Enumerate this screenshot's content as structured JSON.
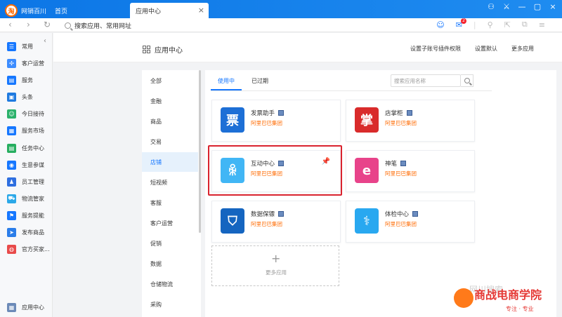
{
  "titlebar": {
    "brand": "网销百川",
    "logo_glyph": "淘",
    "home_tab": "首页",
    "active_tab": "应用中心",
    "close_glyph": "×",
    "window_controls": [
      "⚇",
      "⚔",
      "—",
      "▢",
      "×"
    ]
  },
  "addressbar": {
    "back": "‹",
    "forward": "›",
    "refresh": "↻",
    "search_placeholder": "搜索应用、常用网址",
    "message_badge": "2"
  },
  "sidebar": {
    "collapse": "‹",
    "items": [
      {
        "label": "常用",
        "color": "#1677ff",
        "glyph": "☰"
      },
      {
        "label": "客户运营",
        "color": "#3c8cff",
        "glyph": "✣"
      },
      {
        "label": "服务",
        "color": "#1677ff",
        "glyph": "▤"
      },
      {
        "label": "头条",
        "color": "#1f7ae0",
        "glyph": "▣"
      },
      {
        "label": "今日接待",
        "color": "#2ab16a",
        "glyph": "☺"
      },
      {
        "label": "服务市场",
        "color": "#1677ff",
        "glyph": "▦"
      },
      {
        "label": "任务中心",
        "color": "#27ae60",
        "glyph": "▤"
      },
      {
        "label": "生意参谋",
        "color": "#1677ff",
        "glyph": "◉"
      },
      {
        "label": "员工管理",
        "color": "#2f6fe0",
        "glyph": "♟"
      },
      {
        "label": "物流管家",
        "color": "#2ba8e8",
        "glyph": "⛟"
      },
      {
        "label": "服务提能",
        "color": "#1677ff",
        "glyph": "⚑"
      },
      {
        "label": "发布商品",
        "color": "#2b7de9",
        "glyph": "➤"
      },
      {
        "label": "官方买家...",
        "color": "#e84a4a",
        "glyph": "◍"
      }
    ],
    "bottom": {
      "label": "应用中心",
      "glyph": "▦"
    }
  },
  "header": {
    "title": "应用中心",
    "links": [
      "设置子账号插件权限",
      "设置默认",
      "更多应用"
    ]
  },
  "categories": [
    "全部",
    "金融",
    "商品",
    "交易",
    "店铺",
    "短视频",
    "客服",
    "客户运营",
    "促销",
    "数据",
    "仓储物流",
    "采购"
  ],
  "active_category": "店铺",
  "panel": {
    "tab_active": "使用中",
    "tab_inactive": "已过期",
    "search_placeholder": "搜索应用名称"
  },
  "apps": [
    {
      "name": "发票助手",
      "vendor": "阿里巴巴集团",
      "icon_glyph": "票",
      "color": "#1d6fd6"
    },
    {
      "name": "店掌柜",
      "vendor": "阿里巴巴集团",
      "icon_glyph": "掌",
      "color": "#d92b2b"
    },
    {
      "name": "互动中心",
      "vendor": "阿里巴巴集团",
      "icon_glyph": "ꆜ",
      "color": "#41b6f5",
      "pinned": true
    },
    {
      "name": "神笔",
      "vendor": "阿里巴巴集团",
      "icon_glyph": "e",
      "color": "#e8438a"
    },
    {
      "name": "数据保镖",
      "vendor": "阿里巴巴集团",
      "icon_glyph": "⛉",
      "color": "#1565c0"
    },
    {
      "name": "体检中心",
      "vendor": "阿里巴巴集团",
      "icon_glyph": "⚕",
      "color": "#29a8f0"
    }
  ],
  "pin_glyph": "📌",
  "more_apps": {
    "plus": "+",
    "label": "更多应用"
  },
  "watermark": {
    "title": "商战电商学院",
    "sub": "专注 · 专业",
    "faint": "网川搜索"
  },
  "colors": {
    "accent": "#1677ff",
    "vendor": "#ff6a00",
    "highlight": "#d9232e"
  }
}
